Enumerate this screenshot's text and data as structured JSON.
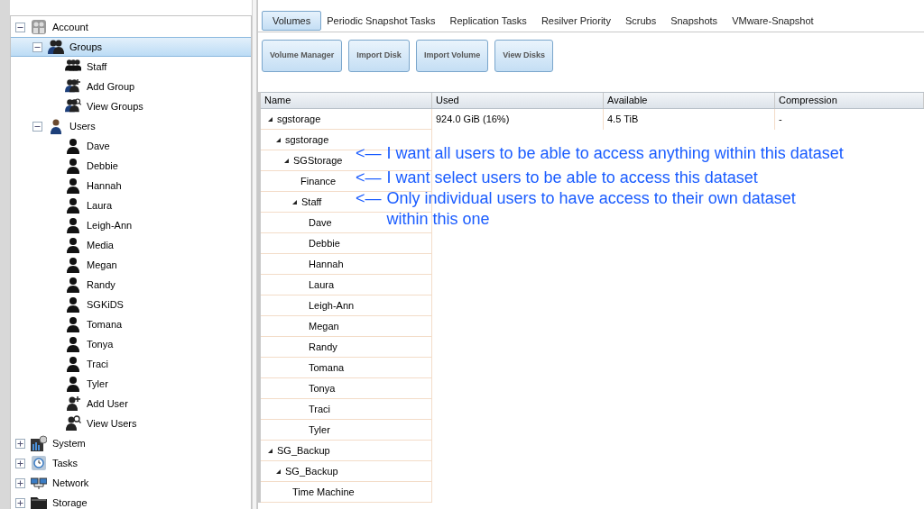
{
  "sidebar": {
    "tree": [
      {
        "label": "Account",
        "kind": "account",
        "expanded": true,
        "selected": false,
        "children": [
          {
            "label": "Groups",
            "kind": "group",
            "expanded": true,
            "selected": true,
            "children": [
              {
                "label": "Staff",
                "kind": "people",
                "selected": false
              },
              {
                "label": "Add Group",
                "kind": "add-group",
                "selected": false
              },
              {
                "label": "View Groups",
                "kind": "view-group",
                "selected": false
              }
            ]
          },
          {
            "label": "Users",
            "kind": "user-blue",
            "expanded": true,
            "selected": false,
            "children": [
              {
                "label": "Dave",
                "kind": "user",
                "selected": false
              },
              {
                "label": "Debbie",
                "kind": "user",
                "selected": false
              },
              {
                "label": "Hannah",
                "kind": "user",
                "selected": false
              },
              {
                "label": "Laura",
                "kind": "user",
                "selected": false
              },
              {
                "label": "Leigh-Ann",
                "kind": "user",
                "selected": false
              },
              {
                "label": "Media",
                "kind": "user",
                "selected": false
              },
              {
                "label": "Megan",
                "kind": "user",
                "selected": false
              },
              {
                "label": "Randy",
                "kind": "user",
                "selected": false
              },
              {
                "label": "SGKiDS",
                "kind": "user",
                "selected": false
              },
              {
                "label": "Tomana",
                "kind": "user",
                "selected": false
              },
              {
                "label": "Tonya",
                "kind": "user",
                "selected": false
              },
              {
                "label": "Traci",
                "kind": "user",
                "selected": false
              },
              {
                "label": "Tyler",
                "kind": "user",
                "selected": false
              },
              {
                "label": "Add User",
                "kind": "add-user",
                "selected": false
              },
              {
                "label": "View Users",
                "kind": "view-user",
                "selected": false
              }
            ]
          }
        ]
      },
      {
        "label": "System",
        "kind": "system",
        "expanded": false,
        "selected": false
      },
      {
        "label": "Tasks",
        "kind": "tasks",
        "expanded": false,
        "selected": false
      },
      {
        "label": "Network",
        "kind": "network",
        "expanded": false,
        "selected": false
      },
      {
        "label": "Storage",
        "kind": "storage",
        "expanded": false,
        "selected": false
      }
    ]
  },
  "tabs": [
    {
      "label": "Volumes",
      "selected": true
    },
    {
      "label": "Periodic Snapshot Tasks",
      "selected": false
    },
    {
      "label": "Replication Tasks",
      "selected": false
    },
    {
      "label": "Resilver Priority",
      "selected": false
    },
    {
      "label": "Scrubs",
      "selected": false
    },
    {
      "label": "Snapshots",
      "selected": false
    },
    {
      "label": "VMware-Snapshot",
      "selected": false
    }
  ],
  "buttons": [
    "Volume Manager",
    "Import Disk",
    "Import Volume",
    "View Disks"
  ],
  "table": {
    "columns": [
      "Name",
      "Used",
      "Available",
      "Compression"
    ],
    "rows": [
      {
        "name": "sgstorage",
        "expanded": true,
        "used": "924.0 GiB (16%)",
        "available": "4.5 TiB",
        "compression": "-",
        "children": [
          {
            "name": "sgstorage",
            "expanded": true,
            "children": [
              {
                "name": "SGStorage",
                "expanded": true,
                "children": [
                  {
                    "name": "Finance"
                  },
                  {
                    "name": "Staff",
                    "expanded": true,
                    "children": [
                      {
                        "name": "Dave"
                      },
                      {
                        "name": "Debbie"
                      },
                      {
                        "name": "Hannah"
                      },
                      {
                        "name": "Laura"
                      },
                      {
                        "name": "Leigh-Ann"
                      },
                      {
                        "name": "Megan"
                      },
                      {
                        "name": "Randy"
                      },
                      {
                        "name": "Tomana"
                      },
                      {
                        "name": "Tonya"
                      },
                      {
                        "name": "Traci"
                      },
                      {
                        "name": "Tyler"
                      }
                    ]
                  }
                ]
              }
            ]
          }
        ]
      },
      {
        "name": "SG_Backup",
        "expanded": true,
        "children": [
          {
            "name": "SG_Backup",
            "expanded": true,
            "children": [
              {
                "name": "Time Machine"
              }
            ]
          }
        ]
      }
    ]
  },
  "annotations": [
    {
      "arrow": "<—",
      "text": "I want all users to be able to access anything within this dataset"
    },
    {
      "arrow": "<—",
      "text": "I want select users to be able to access this dataset"
    },
    {
      "arrow": "<—",
      "text": "Only individual users to have access to their own dataset within this one"
    }
  ]
}
